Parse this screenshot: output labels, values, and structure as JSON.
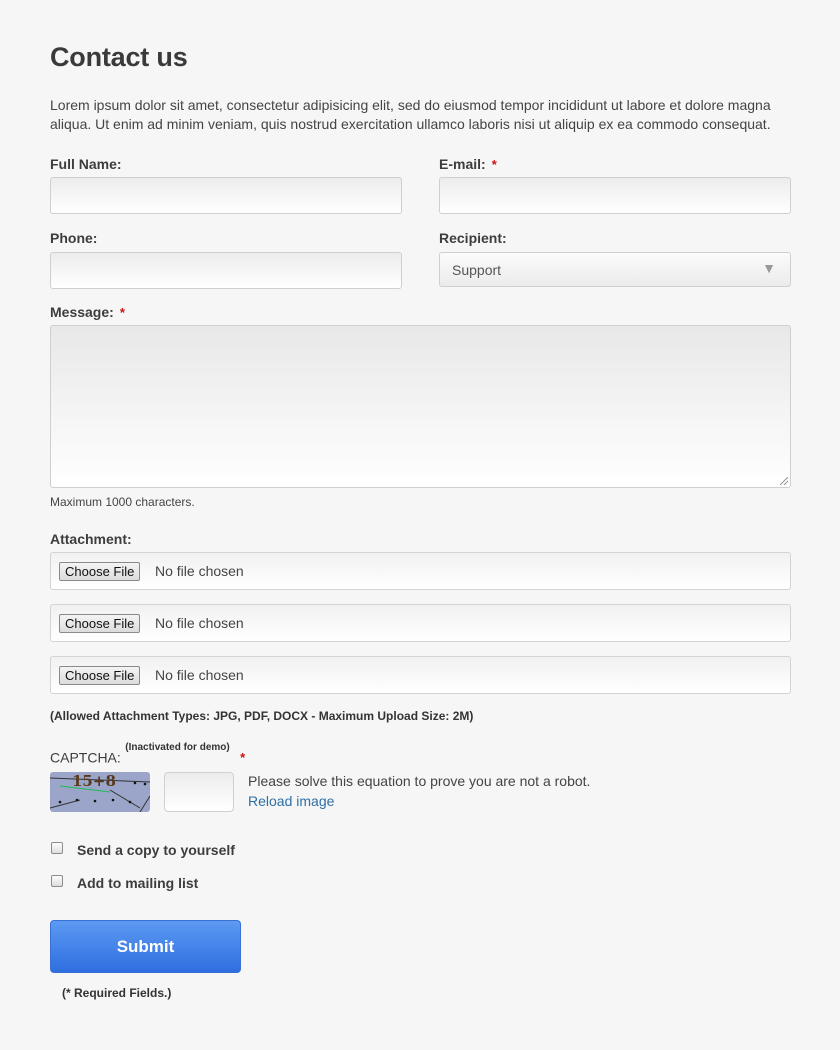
{
  "title": "Contact us",
  "intro": "Lorem ipsum dolor sit amet, consectetur adipisicing elit, sed do eiusmod tempor incididunt ut labore et dolore magna aliqua. Ut enim ad minim veniam, quis nostrud exercitation ullamco laboris nisi ut aliquip ex ea commodo consequat.",
  "form": {
    "full_name": {
      "label": "Full Name:",
      "value": ""
    },
    "email": {
      "label": "E-mail:",
      "required_mark": "*",
      "value": ""
    },
    "phone": {
      "label": "Phone:",
      "value": ""
    },
    "recipient": {
      "label": "Recipient:",
      "selected": "Support",
      "arrow": "▼"
    },
    "message": {
      "label": "Message:",
      "required_mark": "*",
      "value": "",
      "hint": "Maximum 1000 characters."
    },
    "attachment": {
      "label": "Attachment:",
      "inputs": [
        {
          "button": "Choose File",
          "status": "No file chosen"
        },
        {
          "button": "Choose File",
          "status": "No file chosen"
        },
        {
          "button": "Choose File",
          "status": "No file chosen"
        }
      ],
      "allowed": "(Allowed Attachment Types: JPG, PDF, DOCX - Maximum Upload Size: 2M)"
    },
    "captcha": {
      "label": "CAPTCHA:",
      "note": "(Inactivated for demo)",
      "required_mark": "*",
      "image_text": "15+8",
      "instructions": "Please solve this equation to prove you are not a robot.",
      "reload": "Reload image"
    },
    "options": {
      "send_copy": {
        "label": "Send a copy to yourself",
        "checked": false
      },
      "mailing_list": {
        "label": "Add to mailing list",
        "checked": false
      }
    },
    "submit": "Submit",
    "required_note": "(* Required Fields.)"
  },
  "colors": {
    "background": "#f6f6f6",
    "required": "#cc1111",
    "link": "#2e6ea6",
    "submit_top": "#5c9af2",
    "submit_bottom": "#2f6ee0"
  }
}
